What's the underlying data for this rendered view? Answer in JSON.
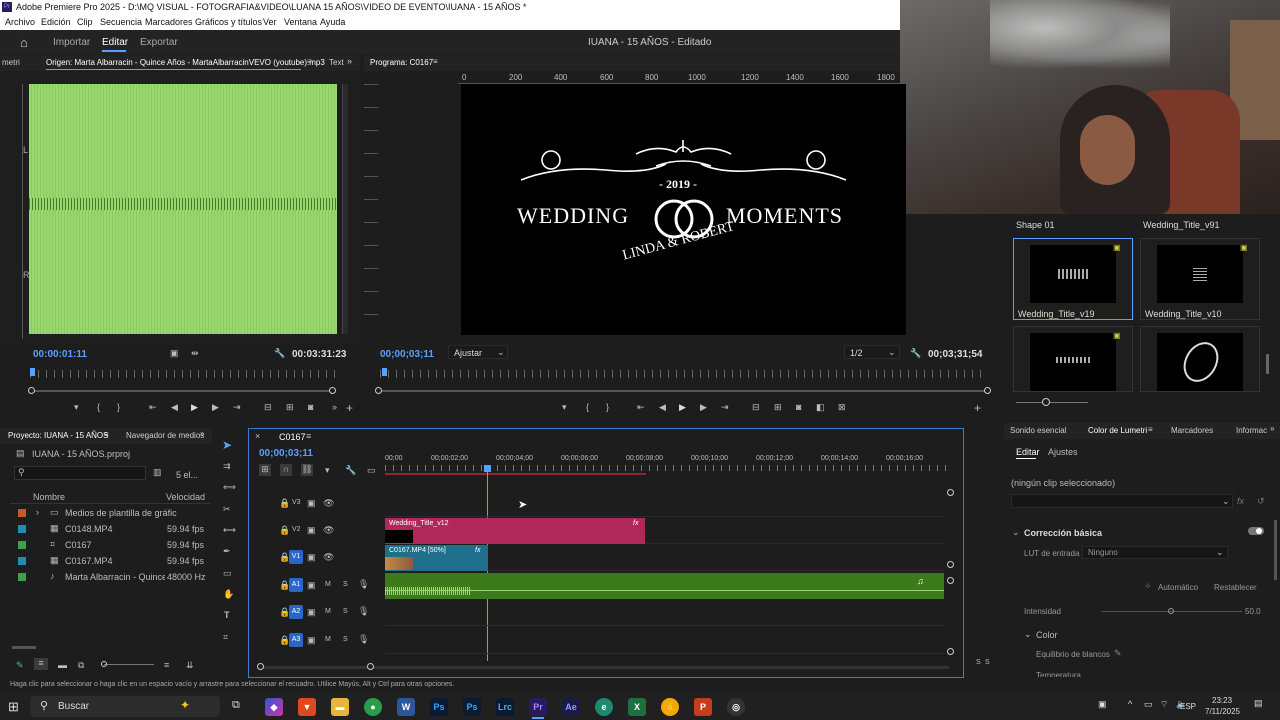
{
  "app": {
    "title": "Adobe Premiere Pro 2025 - D:\\MQ VISUAL - FOTOGRAFIA&VIDEO\\LUANA 15 AÑOS\\VIDEO DE EVENTO\\IUANA - 15 AÑOS *"
  },
  "menu": [
    "Archivo",
    "Edición",
    "Clip",
    "Secuencia",
    "Marcadores",
    "Gráficos y títulos",
    "Ver",
    "Ventana",
    "Ayuda"
  ],
  "nav": {
    "importar": "Importar",
    "editar": "Editar",
    "exportar": "Exportar",
    "project_title": "IUANA - 15 AÑOS - Editado"
  },
  "source": {
    "tab_left": "metri",
    "tab": "Origen: Marta Albarracin - Quince Años - MartaAlbarracinVEVO (youtube).mp3",
    "tab_right": "Text",
    "tc_in": "00:00:01:11",
    "tc_dur": "00:03:31:23",
    "ch_L": "L",
    "ch_R": "R"
  },
  "program": {
    "tab": "Programa: C0167",
    "ruler": [
      "0",
      "200",
      "400",
      "600",
      "800",
      "1000",
      "1200",
      "1400",
      "1600",
      "1800"
    ],
    "year": "- 2019 -",
    "wedding": "WEDDING",
    "moments": "MOMENTS",
    "names": "LINDA & ROBERT",
    "tc": "00;00;03;11",
    "fit": "Ajustar",
    "res": "1/2",
    "dur": "00;03;31;54"
  },
  "project": {
    "tab": "Proyecto: IUANA - 15 AÑOS",
    "tab2": "Navegador de medios",
    "file": "IUANA - 15 AÑOS.prproj",
    "count": "5 el...",
    "col_name": "Nombre",
    "col_speed": "Velocidad",
    "items": [
      {
        "name": "Medios de plantilla de gráfic",
        "speed": "",
        "color": "#c85a28"
      },
      {
        "name": "C0148.MP4",
        "speed": "59.94 fps",
        "color": "#1d8fb3"
      },
      {
        "name": "C0167",
        "speed": "59.94 fps",
        "color": "#3aa34a"
      },
      {
        "name": "C0167.MP4",
        "speed": "59.94 fps",
        "color": "#1d8fb3"
      },
      {
        "name": "Marta Albarracin - Quince Añ",
        "speed": "48000 Hz",
        "color": "#3aa34a"
      }
    ]
  },
  "timeline": {
    "tab": "C0167",
    "tc": "00;00;03;11",
    "ruler": [
      "00;00",
      "00;00;02;00",
      "00;00;04;00",
      "00;00;06;00",
      "00;00;08;00",
      "00;00;10;00",
      "00;00;12;00",
      "00;00;14;00",
      "00;00;16;00"
    ],
    "tracks": [
      {
        "name": "V3"
      },
      {
        "name": "V2"
      },
      {
        "name": "V1"
      },
      {
        "name": "A1"
      },
      {
        "name": "A2"
      },
      {
        "name": "A3"
      }
    ],
    "clip_title": "Wedding_Title_v12",
    "clip_video": "C0167.MP4 [50%]",
    "fx": "fx",
    "mute": "M",
    "solo": "S"
  },
  "graphics": {
    "items": [
      {
        "name": "Shape 01"
      },
      {
        "name": "Wedding_Title_v91"
      },
      {
        "name": "Wedding_Title_v19"
      },
      {
        "name": "Wedding_Title_v10"
      }
    ]
  },
  "lumetri": {
    "tabs": [
      "Sonido esencial",
      "Color de Lumetri",
      "Marcadores",
      "Informac"
    ],
    "subtabs": [
      "Editar",
      "Ajustes"
    ],
    "noclip": "(ningún clip seleccionado)",
    "section": "Corrección básica",
    "lut_label": "LUT de entrada",
    "lut_value": "Ninguno",
    "auto": "Automático",
    "reset": "Restablecer",
    "intensity": "Intensidad",
    "intensity_val": "50.0",
    "color": "Color",
    "wb": "Equilibrio de blancos",
    "temp": "Temperatura"
  },
  "status": "Haga clic para seleccionar o haga clic en un espacio vacío y arrastre para seleccionar el recuadro. Utilice Mayús, Alt y Ctrl para otras opciones.",
  "taskbar": {
    "search": "Buscar",
    "lang": "ESP",
    "time": "23:23",
    "date": "7/11/2025"
  }
}
